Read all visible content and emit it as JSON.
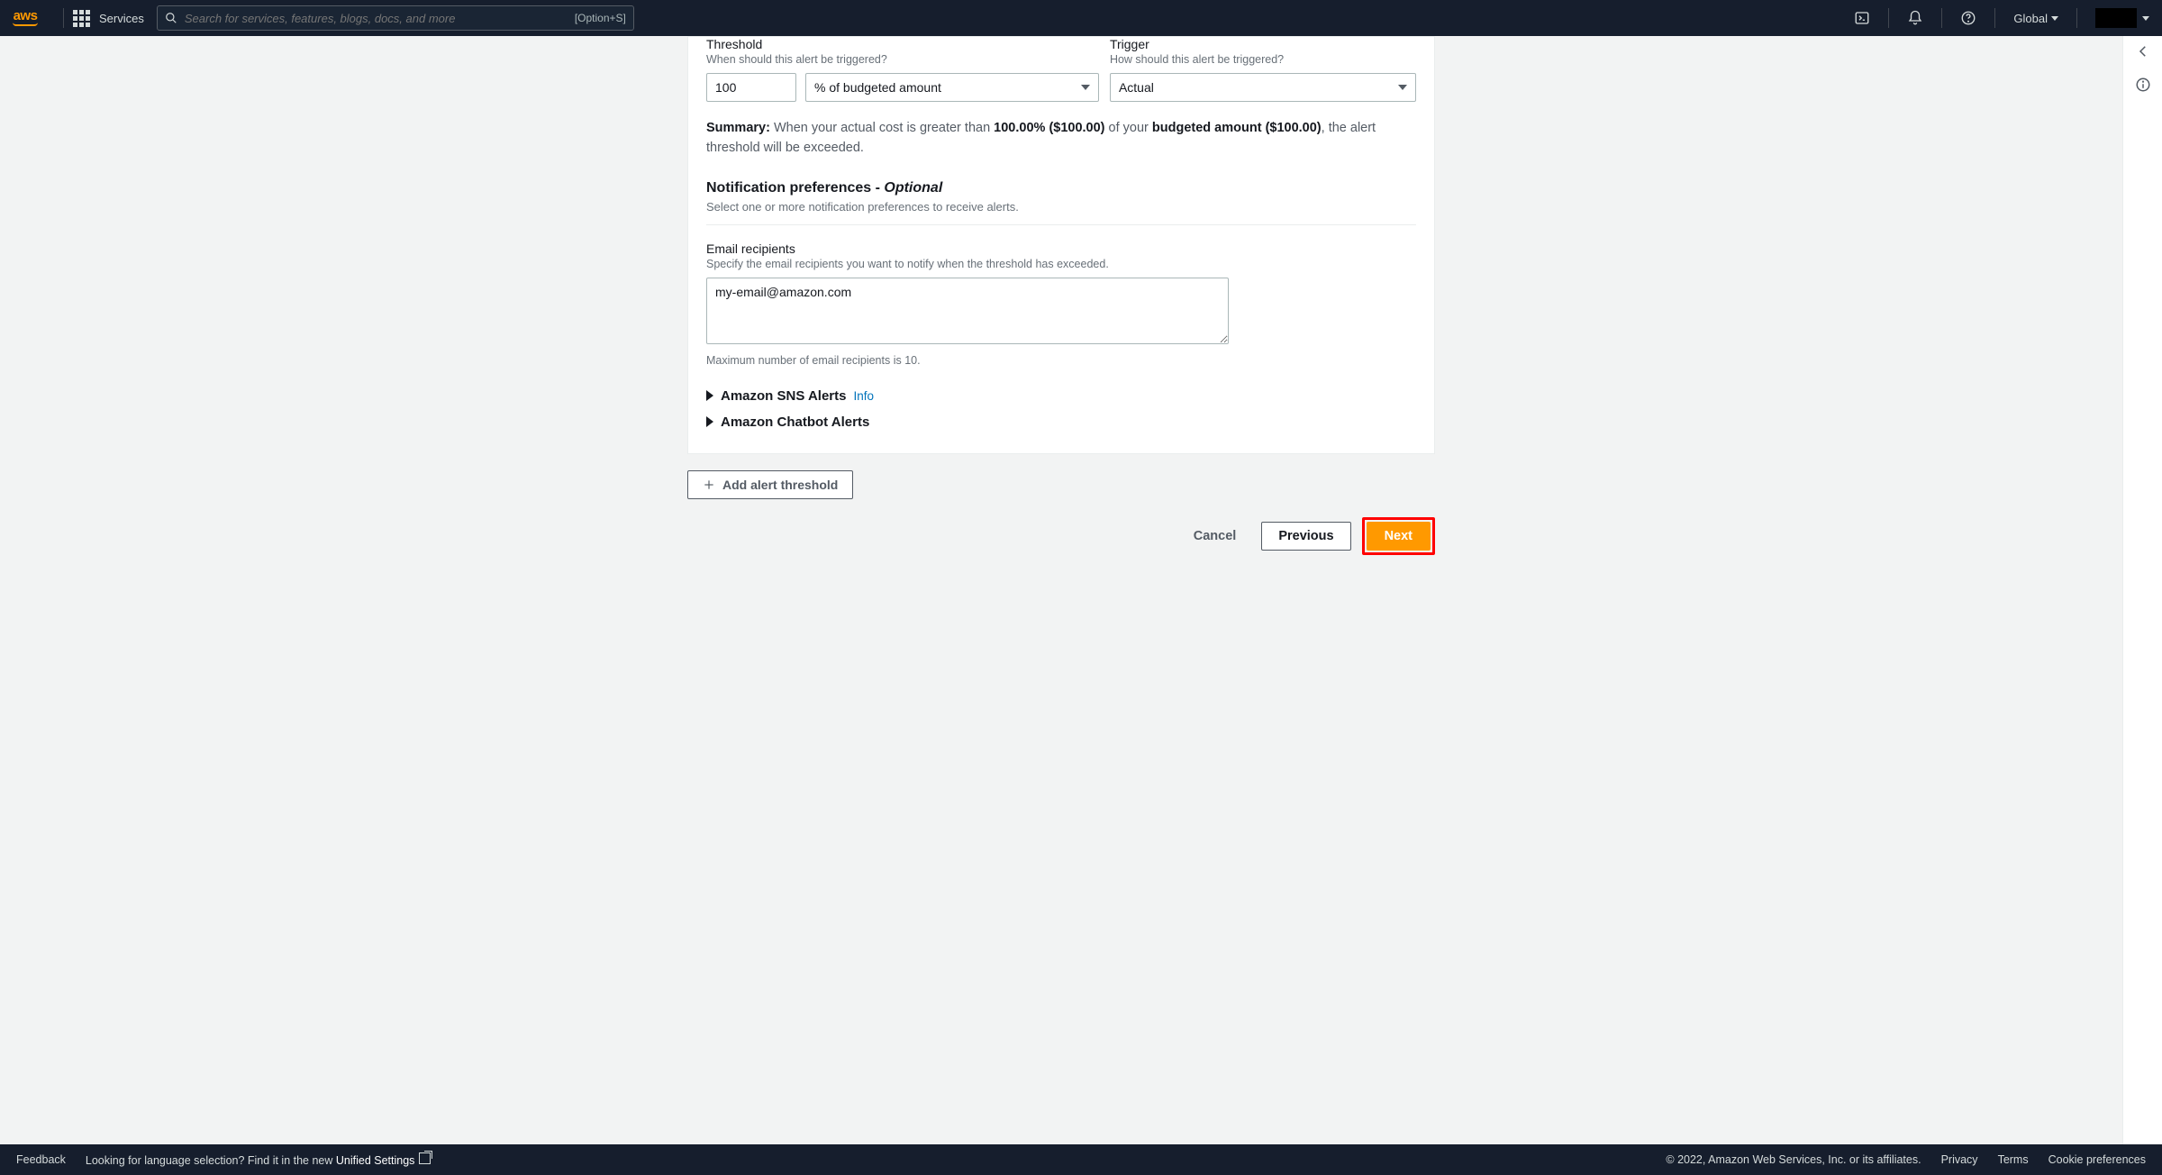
{
  "nav": {
    "services_label": "Services",
    "search_placeholder": "Search for services, features, blogs, docs, and more",
    "search_hint": "[Option+S]",
    "region": "Global"
  },
  "threshold": {
    "label": "Threshold",
    "desc": "When should this alert be triggered?",
    "value": "100",
    "unit": "% of budgeted amount"
  },
  "trigger": {
    "label": "Trigger",
    "desc": "How should this alert be triggered?",
    "value": "Actual"
  },
  "summary": {
    "prefix": "Summary: ",
    "text1": "When your actual cost is greater than ",
    "pct": "100.00% ($100.00)",
    "text2": " of your ",
    "budget": "budgeted amount ($100.00)",
    "text3": ", the alert threshold will be exceeded."
  },
  "notif": {
    "heading": "Notification preferences - ",
    "optional": "Optional",
    "desc": "Select one or more notification preferences to receive alerts."
  },
  "email": {
    "label": "Email recipients",
    "desc": "Specify the email recipients you want to notify when the threshold has exceeded.",
    "value": "my-email@amazon.com",
    "hint": "Maximum number of email recipients is 10."
  },
  "expanders": {
    "sns": "Amazon SNS Alerts",
    "sns_info": "Info",
    "chatbot": "Amazon Chatbot Alerts"
  },
  "buttons": {
    "add_threshold": "Add alert threshold",
    "cancel": "Cancel",
    "previous": "Previous",
    "next": "Next"
  },
  "footer": {
    "feedback": "Feedback",
    "lang_prompt": "Looking for language selection? Find it in the new ",
    "lang_link": "Unified Settings",
    "copyright": "© 2022, Amazon Web Services, Inc. or its affiliates.",
    "privacy": "Privacy",
    "terms": "Terms",
    "cookie": "Cookie preferences"
  }
}
